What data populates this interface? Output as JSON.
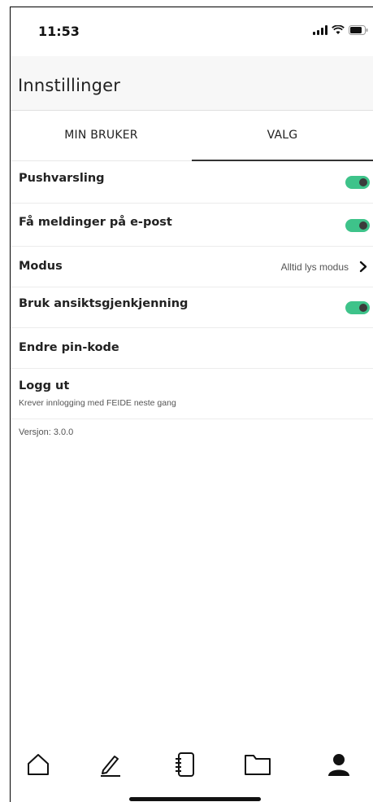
{
  "status_bar": {
    "time": "11:53"
  },
  "header": {
    "title": "Innstillinger"
  },
  "tabs": [
    {
      "label": "MIN BRUKER",
      "active": false
    },
    {
      "label": "VALG",
      "active": true
    }
  ],
  "settings": {
    "push": {
      "label": "Pushvarsling",
      "enabled": true
    },
    "email": {
      "label": "Få meldinger på e-post",
      "enabled": true
    },
    "mode": {
      "label": "Modus",
      "value": "Alltid lys modus"
    },
    "faceid": {
      "label": "Bruk ansiktsgjenkjenning",
      "enabled": true
    },
    "pin": {
      "label": "Endre pin-kode"
    },
    "logout": {
      "label": "Logg ut",
      "subtitle": "Krever innlogging med FEIDE neste gang"
    }
  },
  "version": {
    "label": "Versjon:",
    "value": "3.0.0"
  },
  "bottom_nav": [
    "home-icon",
    "pencil-icon",
    "notebook-icon",
    "folder-icon",
    "profile-icon"
  ],
  "colors": {
    "toggle_on": "#3ec38a",
    "knob": "#3b3b3b",
    "header_bg": "#f7f7f7"
  }
}
